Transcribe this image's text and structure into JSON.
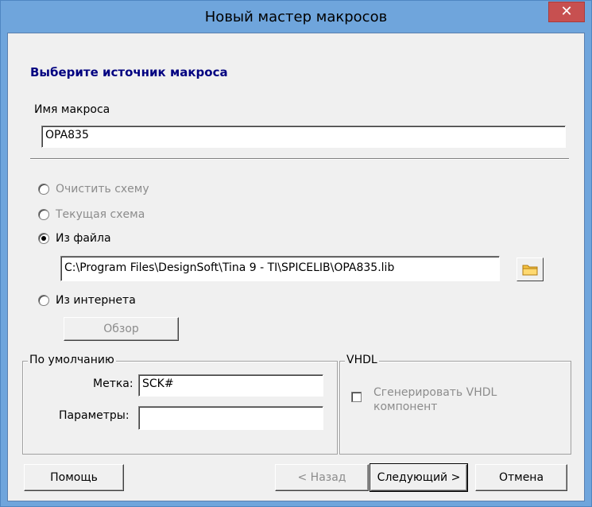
{
  "window": {
    "title": "Новый мастер макросов",
    "close_glyph": "✕"
  },
  "heading": "Выберите источник макроса",
  "macro_name": {
    "label": "Имя макроса",
    "value": "OPA835"
  },
  "source_options": [
    {
      "label": "Очистить схему",
      "checked": false,
      "enabled": false
    },
    {
      "label": "Текущая схема",
      "checked": false,
      "enabled": false
    },
    {
      "label": "Из файла",
      "checked": true,
      "enabled": true
    },
    {
      "label": "Из интернета",
      "checked": false,
      "enabled": true
    }
  ],
  "file_path": "C:\\Program Files\\DesignSoft\\Tina 9 - TI\\SPICELIB\\OPA835.lib",
  "browse_button": "Обзор",
  "defaults_group": {
    "title": "По умолчанию",
    "label_field": {
      "label": "Метка:",
      "value": "SCK#"
    },
    "params_field": {
      "label": "Параметры:",
      "value": ""
    }
  },
  "vhdl_group": {
    "title": "VHDL",
    "checkbox_label_line1": "Сгенерировать VHDL",
    "checkbox_label_line2": "компонент",
    "checked": false
  },
  "buttons": {
    "help": "Помощь",
    "back": "< Назад",
    "next": "Следующий >",
    "cancel": "Отмена"
  },
  "colors": {
    "title_bar": "#6fa5dc",
    "close": "#c75050",
    "heading": "#000080"
  }
}
